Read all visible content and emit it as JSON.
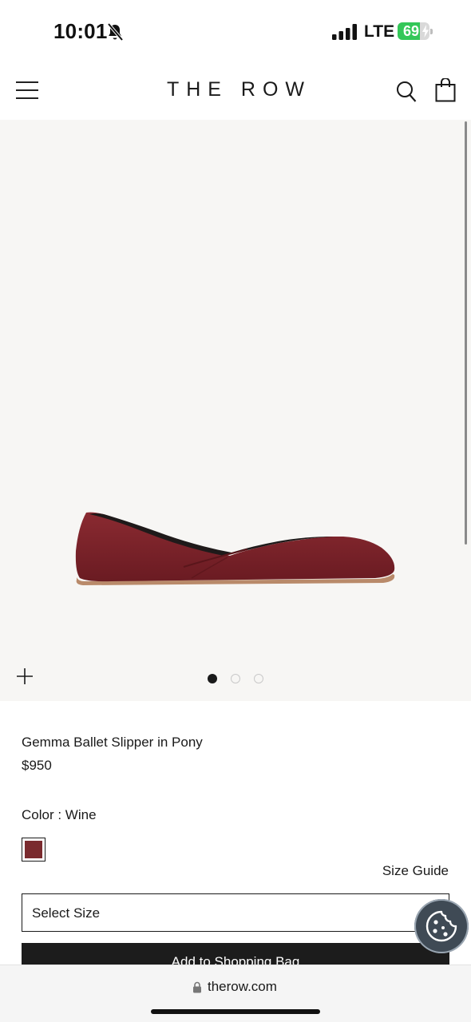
{
  "status_bar": {
    "time": "10:01",
    "network": "LTE",
    "battery": "69",
    "battery_level": 0.69,
    "icons": [
      "bell-slash-icon",
      "signal-bars-icon",
      "battery-icon",
      "charging-bolt-icon"
    ]
  },
  "header": {
    "brand": "THE ROW",
    "icons": [
      "hamburger-menu-icon",
      "search-icon",
      "shopping-bag-icon"
    ]
  },
  "gallery": {
    "image_alt": "Gemma Ballet Slipper in Pony",
    "slide_count": 3,
    "active_slide": 1,
    "icons": [
      "plus-icon"
    ]
  },
  "product": {
    "name": "Gemma Ballet Slipper in Pony",
    "price": "$950",
    "color_label": "Color : Wine",
    "swatch_color": "#7a2a2e",
    "size_guide": "Size Guide",
    "size_select": "Select Size",
    "add_to_bag": "Add to Shopping Bag"
  },
  "cookie_button": {
    "icon": "cookie-icon"
  },
  "browser": {
    "url": "therow.com",
    "icons": [
      "lock-icon"
    ]
  },
  "colors": {
    "gallery_bg": "#f7f6f4",
    "shoe": "#7a2228",
    "button_bg": "#1c1c1c",
    "battery_green": "#34c759"
  }
}
